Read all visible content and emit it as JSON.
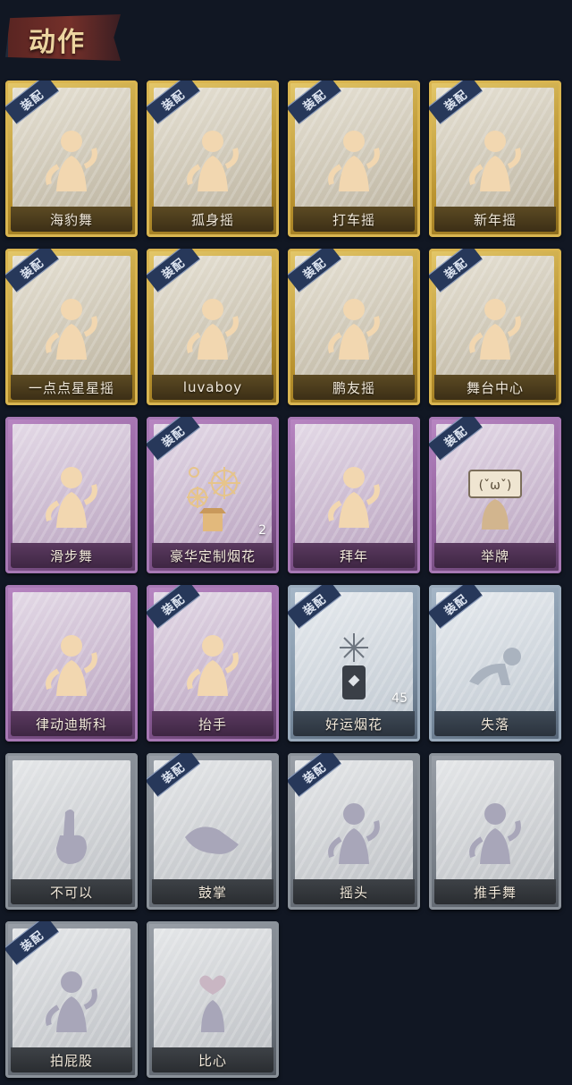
{
  "header": {
    "title": "动作"
  },
  "badge_text": "装配",
  "cards": [
    {
      "label": "海豹舞",
      "tier": "gold",
      "equipped": true,
      "icon": "dance-pose-icon"
    },
    {
      "label": "孤身摇",
      "tier": "gold",
      "equipped": true,
      "icon": "dance-pose-icon"
    },
    {
      "label": "打车摇",
      "tier": "gold",
      "equipped": true,
      "icon": "dance-pose-icon"
    },
    {
      "label": "新年摇",
      "tier": "gold",
      "equipped": true,
      "icon": "dance-pose-icon"
    },
    {
      "label": "一点点星星摇",
      "tier": "gold",
      "equipped": true,
      "icon": "dance-pose-icon"
    },
    {
      "label": "luvaboy",
      "tier": "gold",
      "equipped": true,
      "icon": "dance-pose-icon"
    },
    {
      "label": "鹏友摇",
      "tier": "gold",
      "equipped": true,
      "icon": "dance-pose-icon"
    },
    {
      "label": "舞台中心",
      "tier": "gold",
      "equipped": true,
      "icon": "dance-pose-icon"
    },
    {
      "label": "滑步舞",
      "tier": "purple",
      "equipped": false,
      "icon": "dance-pose-icon"
    },
    {
      "label": "豪华定制烟花",
      "tier": "purple",
      "equipped": true,
      "icon": "firework-box-icon",
      "count": "2"
    },
    {
      "label": "拜年",
      "tier": "purple",
      "equipped": false,
      "icon": "bow-pose-icon"
    },
    {
      "label": "举牌",
      "tier": "purple",
      "equipped": true,
      "icon": "hold-sign-icon"
    },
    {
      "label": "律动迪斯科",
      "tier": "purple",
      "equipped": false,
      "icon": "disco-pose-icon"
    },
    {
      "label": "抬手",
      "tier": "purple",
      "equipped": true,
      "icon": "raise-hand-icon"
    },
    {
      "label": "好运烟花",
      "tier": "blue",
      "equipped": true,
      "icon": "firework-can-icon",
      "count": "45"
    },
    {
      "label": "失落",
      "tier": "blue",
      "equipped": true,
      "icon": "crawl-pose-icon"
    },
    {
      "label": "不可以",
      "tier": "gray",
      "equipped": false,
      "icon": "finger-wag-icon"
    },
    {
      "label": "鼓掌",
      "tier": "gray",
      "equipped": true,
      "icon": "clap-hands-icon"
    },
    {
      "label": "摇头",
      "tier": "gray",
      "equipped": true,
      "icon": "shake-head-icon"
    },
    {
      "label": "推手舞",
      "tier": "gray",
      "equipped": false,
      "icon": "push-hand-icon"
    },
    {
      "label": "拍屁股",
      "tier": "gray",
      "equipped": true,
      "icon": "pat-pose-icon"
    },
    {
      "label": "比心",
      "tier": "gray",
      "equipped": false,
      "icon": "heart-hand-icon"
    }
  ]
}
